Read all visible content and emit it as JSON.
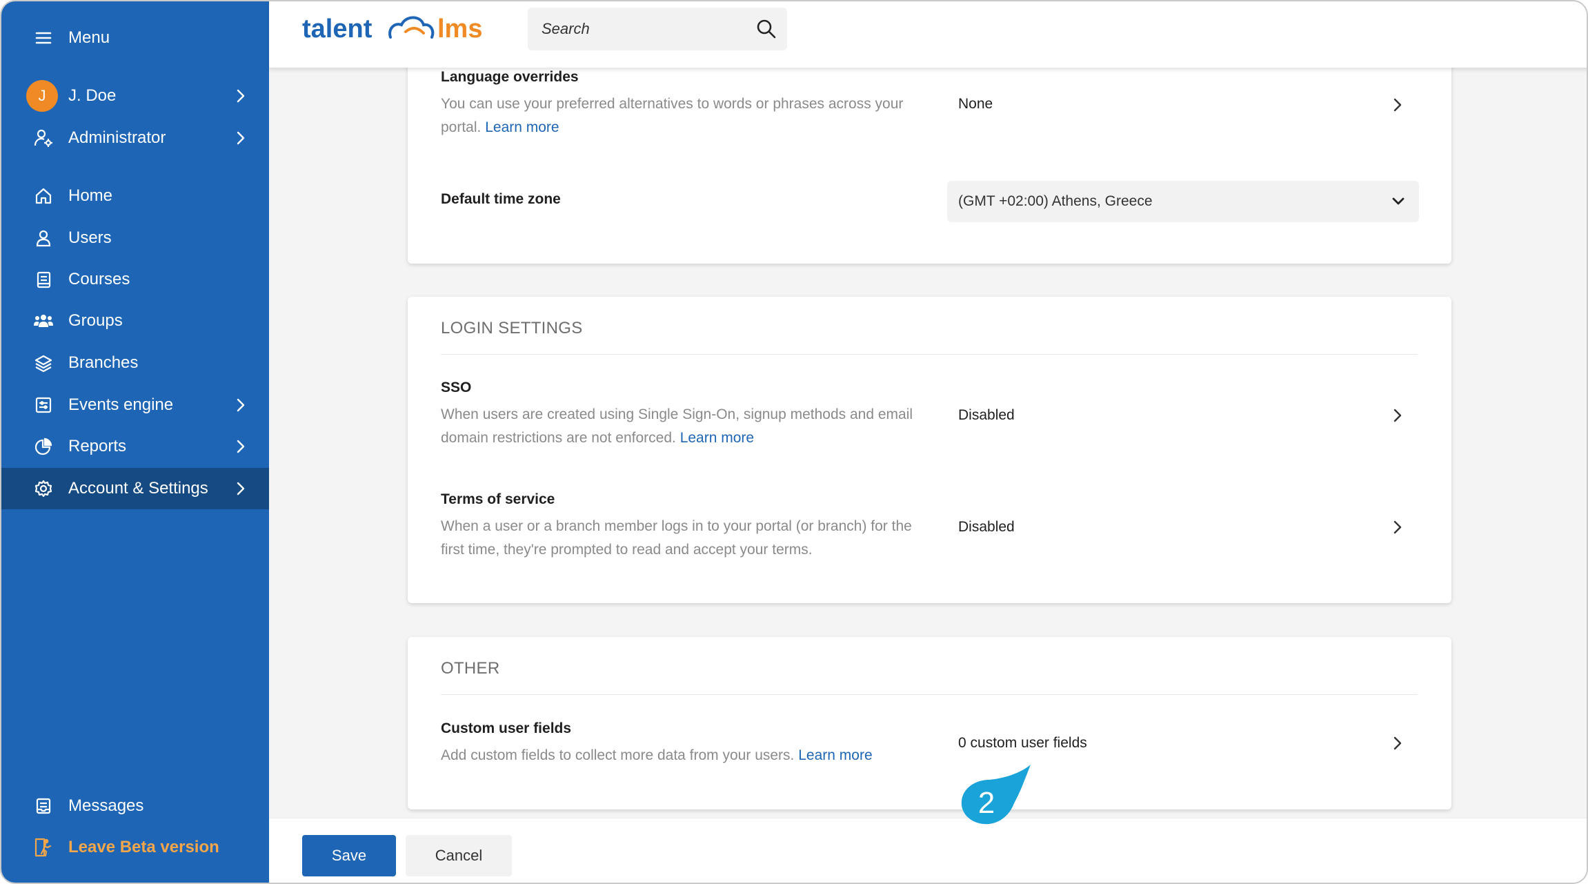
{
  "sidebar": {
    "menu_label": "Menu",
    "user": {
      "initial": "J",
      "name": "J. Doe"
    },
    "role": "Administrator",
    "items": [
      {
        "label": "Home",
        "icon": "home-icon"
      },
      {
        "label": "Users",
        "icon": "user-icon"
      },
      {
        "label": "Courses",
        "icon": "book-icon"
      },
      {
        "label": "Groups",
        "icon": "group-icon"
      },
      {
        "label": "Branches",
        "icon": "layers-icon"
      },
      {
        "label": "Events engine",
        "icon": "events-icon"
      },
      {
        "label": "Reports",
        "icon": "pie-chart-icon"
      },
      {
        "label": "Account & Settings",
        "icon": "gear-icon"
      }
    ],
    "messages": "Messages",
    "leave_beta": "Leave Beta version"
  },
  "topbar": {
    "logo_left": "talent",
    "logo_right": "lms",
    "search_placeholder": "Search"
  },
  "language_overrides": {
    "title": "Language overrides",
    "desc": "You can use your preferred alternatives to words or phrases across your portal.",
    "learn_more": "Learn more",
    "value": "None"
  },
  "time_zone": {
    "title": "Default time zone",
    "value": "(GMT +02:00) Athens, Greece"
  },
  "login_settings": {
    "section_title": "LOGIN SETTINGS",
    "sso": {
      "title": "SSO",
      "desc": "When users are created using Single Sign-On, signup methods and email domain restrictions are not enforced.",
      "learn_more": "Learn more",
      "value": "Disabled"
    },
    "terms": {
      "title": "Terms of service",
      "desc": "When a user or a branch member logs in to your portal (or branch) for the first time, they're prompted to read and accept your terms.",
      "value": "Disabled"
    }
  },
  "other": {
    "section_title": "OTHER",
    "custom_fields": {
      "title": "Custom user fields",
      "desc": "Add custom fields to collect more data from your users.",
      "learn_more": "Learn more",
      "value": "0 custom user fields"
    }
  },
  "footer": {
    "save": "Save",
    "cancel": "Cancel"
  },
  "callout_number": "2",
  "colors": {
    "brand_blue": "#1e66b5",
    "active_nav": "#164a82",
    "accent_orange": "#f08a24",
    "callout": "#1aa3d9"
  }
}
